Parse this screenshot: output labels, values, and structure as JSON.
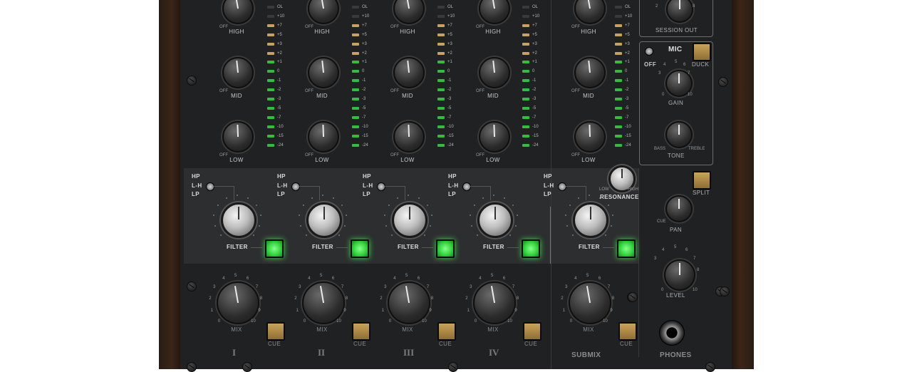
{
  "channels": [
    {
      "id": "I",
      "eq_labels": [
        "HIGH",
        "MID",
        "LOW"
      ],
      "off": "OFF",
      "filter": "FILTER",
      "mix": "MIX",
      "cue": "CUE",
      "roman": "I"
    },
    {
      "id": "II",
      "eq_labels": [
        "HIGH",
        "MID",
        "LOW"
      ],
      "off": "OFF",
      "filter": "FILTER",
      "mix": "MIX",
      "cue": "CUE",
      "roman": "II"
    },
    {
      "id": "III",
      "eq_labels": [
        "HIGH",
        "MID",
        "LOW"
      ],
      "off": "OFF",
      "filter": "FILTER",
      "mix": "MIX",
      "cue": "CUE",
      "roman": "III"
    },
    {
      "id": "IV",
      "eq_labels": [
        "HIGH",
        "MID",
        "LOW"
      ],
      "off": "OFF",
      "filter": "FILTER",
      "mix": "MIX",
      "cue": "CUE",
      "roman": "IV"
    },
    {
      "id": "SUBMIX",
      "eq_labels": [
        "HIGH",
        "MID",
        "LOW"
      ],
      "off": "OFF",
      "filter": "FILTER",
      "mix": "MIX",
      "cue": "CUE",
      "roman": "SUBMIX"
    }
  ],
  "filter_modes": {
    "hp": "HP",
    "lh": "L-H",
    "lp": "LP"
  },
  "meter_scale": [
    "OL",
    "+10",
    "+7",
    "+5",
    "+3",
    "+2",
    "+1",
    "0",
    "-1",
    "-2",
    "-3",
    "-5",
    "-7",
    "-10",
    "-15",
    "-24"
  ],
  "mix_scale": [
    "0",
    "1",
    "2",
    "3",
    "4",
    "5",
    "6",
    "7",
    "8",
    "9",
    "10"
  ],
  "resonance": {
    "label": "RESONANCE",
    "low": "LOW",
    "high": "HIGH"
  },
  "right_panel": {
    "session_out": "SESSION OUT",
    "mic": "MIC",
    "off": "OFF",
    "duck": "DUCK",
    "gain": "GAIN",
    "tone": "TONE",
    "bass": "BASS",
    "treble": "TREBLE",
    "split": "SPLIT",
    "pan": "PAN",
    "cue": "CUE",
    "level": "LEVEL",
    "phones": "PHONES",
    "scale_top": [
      "2",
      "8"
    ],
    "scale_gain": [
      "3",
      "4",
      "5",
      "6",
      "7",
      "0",
      "10"
    ],
    "scale_level": [
      "3",
      "4",
      "5",
      "6",
      "7",
      "8",
      "0",
      "10"
    ]
  },
  "colors": {
    "led_green": "#3ee64a",
    "led_amber": "#c9a35a",
    "faceplate": "#202122",
    "wood": "#3b2518"
  }
}
